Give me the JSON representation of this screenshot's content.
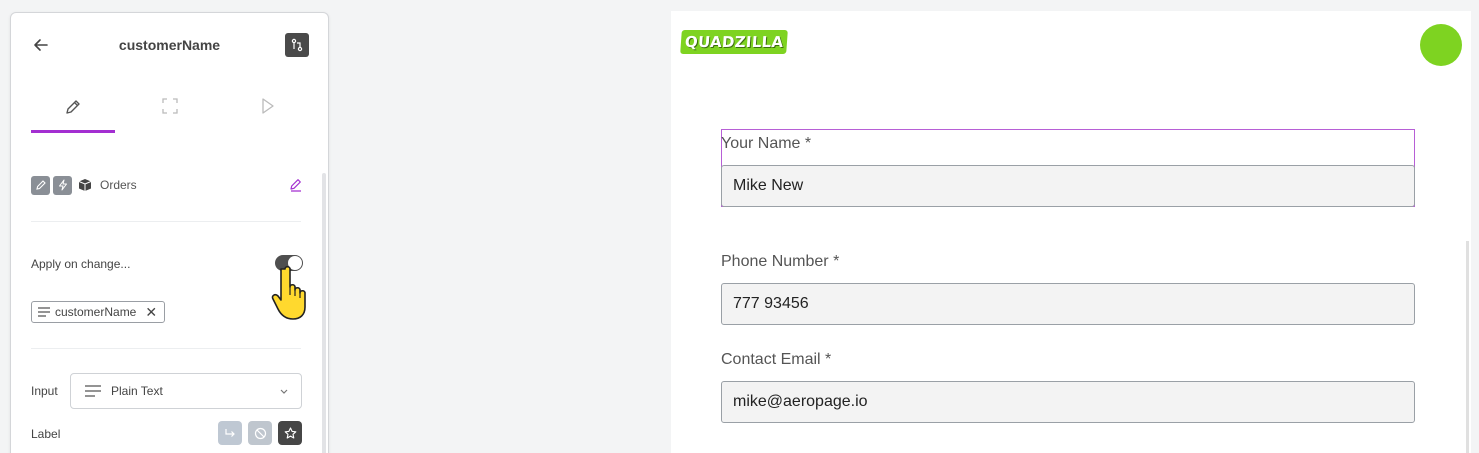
{
  "panel": {
    "title": "customerName",
    "tabs": [
      "edit",
      "frame",
      "preview"
    ],
    "source": {
      "label": "Orders"
    },
    "apply_on_change": {
      "label": "Apply on change...",
      "enabled": true
    },
    "chip": {
      "label": "customerName"
    },
    "input": {
      "label": "Input",
      "value": "Plain Text"
    },
    "label_row": {
      "label": "Label"
    }
  },
  "preview": {
    "logo": "QUADZILLA",
    "fields": [
      {
        "label": "Your Name *",
        "value": "Mike New"
      },
      {
        "label": "Phone Number *",
        "value": "777 93456"
      },
      {
        "label": "Contact Email *",
        "value": "mike@aeropage.io"
      }
    ]
  },
  "colors": {
    "accent": "#a32fd1",
    "brand": "#7ed321",
    "toggle": "#4f4f4f"
  }
}
